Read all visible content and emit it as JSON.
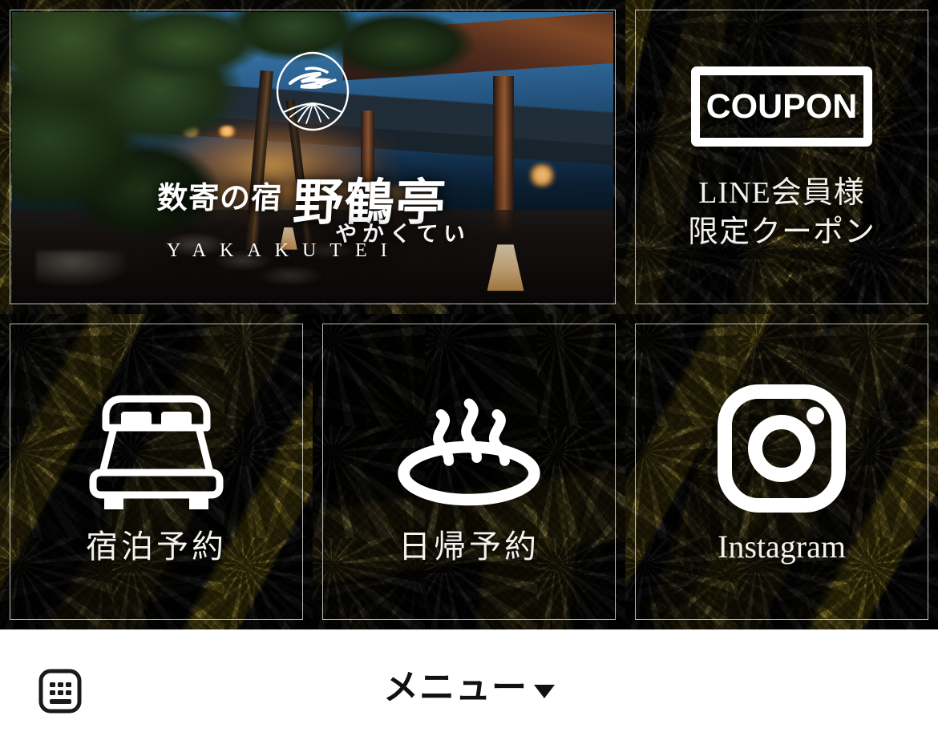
{
  "rich_menu": {
    "hero": {
      "name": "hero-banner",
      "inn_subtitle": "数寄の宿",
      "inn_name": "野鶴亭",
      "inn_kana": "やかくてい",
      "inn_roman": "YAKAKUTEI",
      "logo_icon": "crane-circle-logo-icon",
      "photo_description": "ryokan-entrance-at-dusk"
    },
    "coupon": {
      "name": "coupon-tile",
      "badge_text": "COUPON",
      "caption_line1": "LINE会員様",
      "caption_line2": "限定クーポン",
      "icon": "coupon-box-icon"
    },
    "tiles": [
      {
        "name": "stay-reservation-tile",
        "label": "宿泊予約",
        "icon": "bed-icon"
      },
      {
        "name": "day-use-reservation-tile",
        "label": "日帰予約",
        "icon": "onsen-hot-spring-icon"
      },
      {
        "name": "instagram-tile",
        "label": "Instagram",
        "icon": "instagram-icon"
      }
    ]
  },
  "chat_bar": {
    "keyboard_icon": "keyboard-icon",
    "menu_label": "メニュー",
    "menu_caret_icon": "caret-down-icon"
  },
  "colors": {
    "background_dark": "#141310",
    "gold_accent": "#c4a314",
    "tile_border": "#ffffff",
    "text_light": "#f4f2ec",
    "chat_bar_bg": "#ffffff",
    "chat_bar_text": "#111111"
  }
}
